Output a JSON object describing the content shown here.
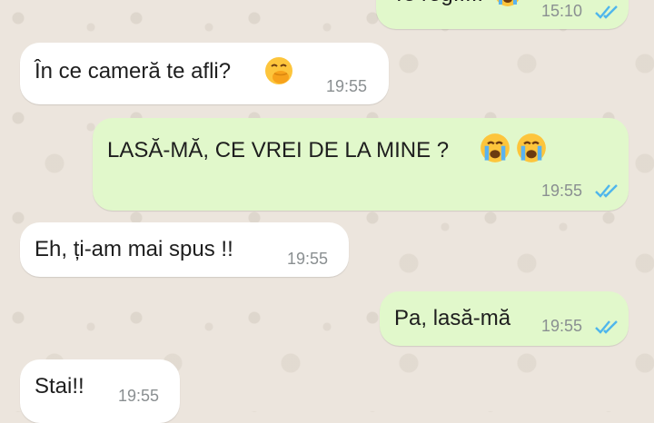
{
  "messages": [
    {
      "text": "Te rog.....",
      "time": "15:10",
      "emoji_after": [
        "crying-face"
      ],
      "read": true
    },
    {
      "text": "În ce cameră te afli?",
      "time": "19:55",
      "emoji_after": [
        "hand-over-mouth-face"
      ]
    },
    {
      "text": "LASĂ-MĂ, CE VREI DE LA MINE ?",
      "time": "19:55",
      "emoji_after": [
        "crying-face",
        "crying-face"
      ],
      "read": true
    },
    {
      "text": "Eh, ți-am mai spus !!",
      "time": "19:55"
    },
    {
      "text": "Pa, lasă-mă",
      "time": "19:55",
      "read": true
    },
    {
      "text": "Stai!!",
      "time": "19:55"
    }
  ],
  "colors": {
    "incoming_bubble": "#ffffff",
    "outgoing_bubble": "#e1f8cb",
    "read_ticks": "#4fb6ec",
    "wallpaper": "#ece5dd"
  }
}
